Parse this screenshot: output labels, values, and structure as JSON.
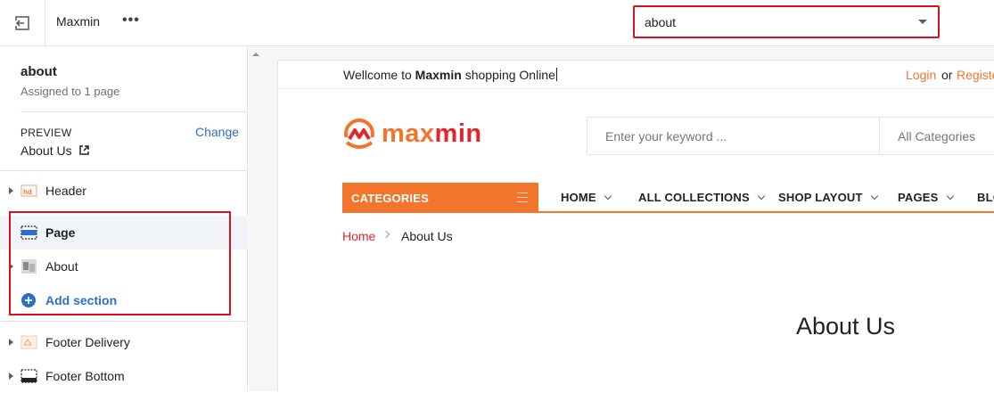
{
  "topbar": {
    "theme_name": "Maxmin",
    "more_label": "•••",
    "template_value": "about"
  },
  "sidebar": {
    "title": "about",
    "subtitle": "Assigned to 1 page",
    "preview_label": "PREVIEW",
    "preview_change": "Change",
    "preview_value": "About Us",
    "sections": [
      {
        "label": "Header",
        "icon": "header-thumbnail-icon"
      },
      {
        "label": "Page",
        "icon": "page-layout-icon"
      },
      {
        "label": "About",
        "icon": "about-thumbnail-icon"
      },
      {
        "label": "Add section",
        "icon": "plus-circle-icon"
      },
      {
        "label": "Footer Delivery",
        "icon": "footer-delivery-thumbnail-icon"
      },
      {
        "label": "Footer Bottom",
        "icon": "footer-bottom-layout-icon"
      }
    ]
  },
  "site": {
    "welcome_prefix": "Wellcome to",
    "welcome_brand": "Maxmin",
    "welcome_suffix": "shopping Online",
    "login": "Login",
    "or": "or",
    "register": "Register",
    "logo_part1": "max",
    "logo_part2": "min",
    "search_placeholder": "Enter your keyword ...",
    "category_select": "All Categories",
    "categories_button": "CATEGORIES",
    "nav": [
      "HOME",
      "ALL COLLECTIONS",
      "SHOP LAYOUT",
      "PAGES",
      "BLOG"
    ],
    "breadcrumb_home": "Home",
    "breadcrumb_current": "About Us",
    "page_heading": "About Us"
  },
  "colors": {
    "accent_orange": "#f3742b",
    "brand_red": "#e2262b",
    "link_blue": "#2c6ecb",
    "highlight_red": "#e00e1a"
  }
}
